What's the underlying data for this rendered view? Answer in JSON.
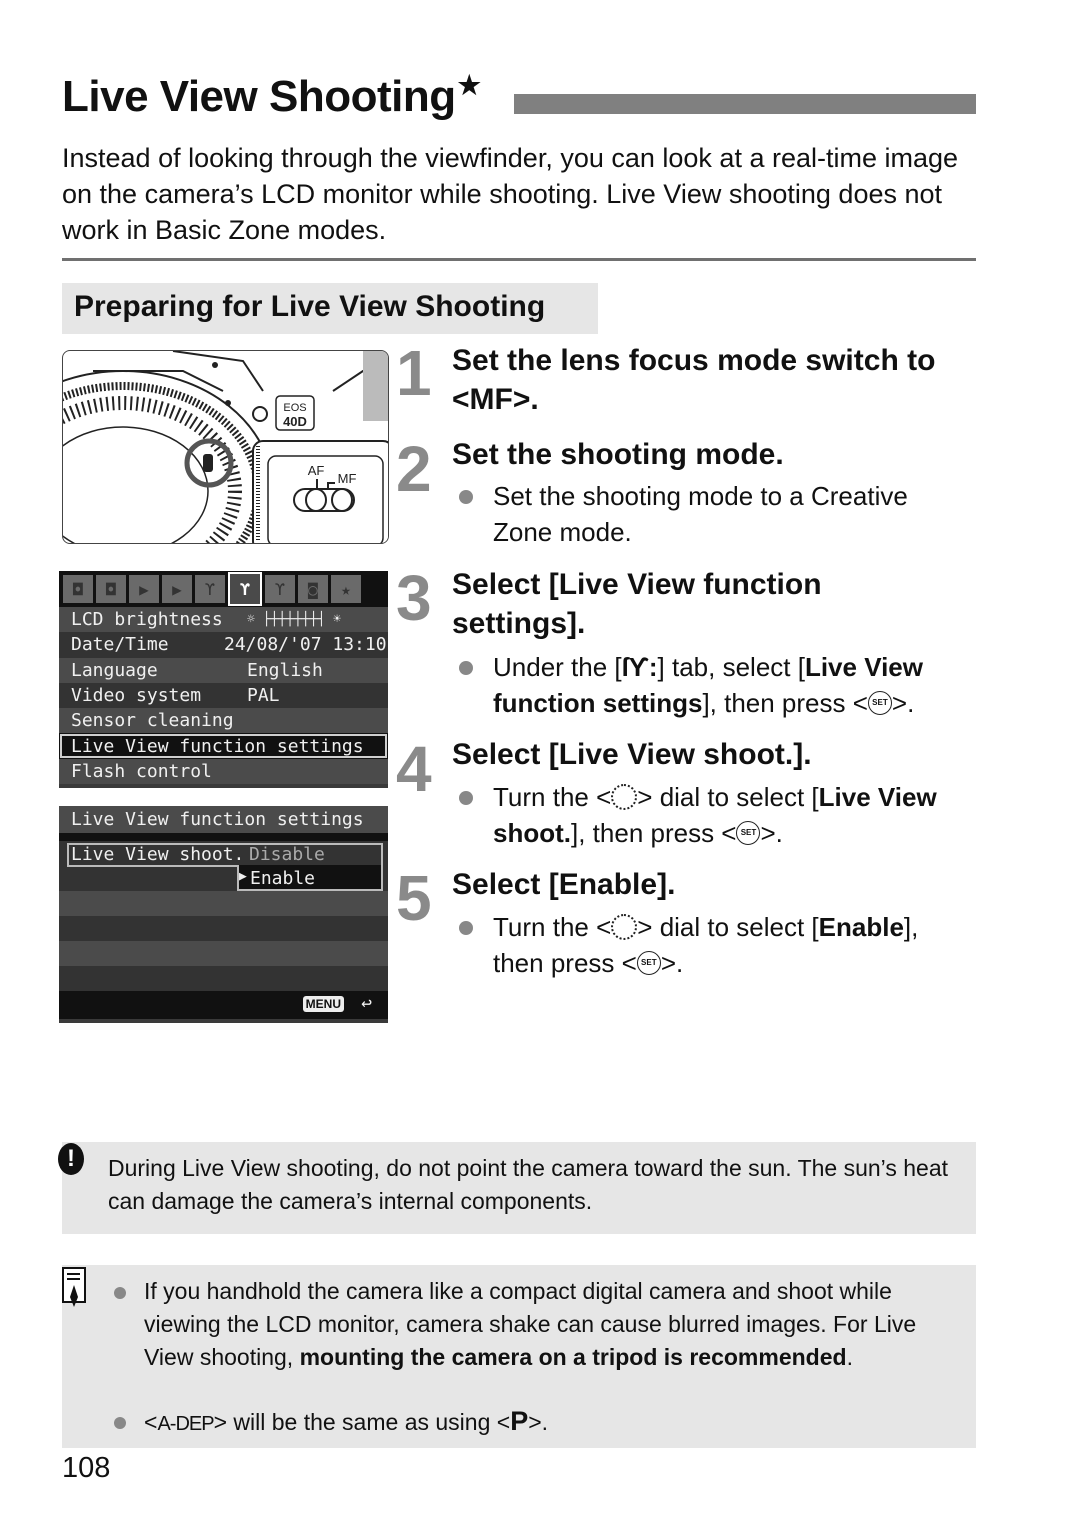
{
  "page": {
    "title": "Live View Shooting",
    "title_star": "★",
    "intro": "Instead of looking through the viewfinder, you can look at a real-time image on the camera’s LCD monitor while shooting. Live View shooting does not work in Basic Zone modes.",
    "section_heading": "Preparing for Live View Shooting",
    "page_number": "108"
  },
  "camera_illustration": {
    "model_badge_line1": "EOS",
    "model_badge_line2": "40D",
    "switch_af": "AF",
    "switch_mf": "MF"
  },
  "lcd_menu": {
    "tabs": [
      "shoot1",
      "shoot2",
      "play1",
      "play2",
      "setup1",
      "setup2",
      "setup3",
      "custom",
      "mymenu"
    ],
    "active_tab": 5,
    "rows": [
      {
        "label": "LCD brightness",
        "value": "☼ ├┼┼┼┼┼┼┤ ☀"
      },
      {
        "label": "Date/Time",
        "value": "24/08/'07 13:10"
      },
      {
        "label": "Language",
        "value": "English"
      },
      {
        "label": "Video system",
        "value": "PAL"
      },
      {
        "label": "Sensor cleaning",
        "value": ""
      },
      {
        "label": "Live View function settings",
        "value": "",
        "selected": true
      },
      {
        "label": "Flash control",
        "value": ""
      }
    ]
  },
  "lcd_submenu": {
    "title": "Live View function settings",
    "item_label": "Live View shoot.",
    "options": [
      "Disable",
      "Enable"
    ],
    "selected_option": "Enable",
    "menu_button": "MENU",
    "back_glyph": "↩"
  },
  "steps": [
    {
      "num": "1",
      "title": "Set the lens focus mode switch to <MF>."
    },
    {
      "num": "2",
      "title": "Set the shooting mode.",
      "bullet": "Set the shooting mode to a Creative Zone mode."
    },
    {
      "num": "3",
      "title": "Select [Live View function settings].",
      "bullet_parts": [
        "Under the [",
        "] tab, select [",
        "Live View function settings",
        "], then press <",
        ">."
      ]
    },
    {
      "num": "4",
      "title": "Select [Live View shoot.].",
      "bullet_parts": [
        "Turn the <",
        "> dial to select [",
        "Live View shoot.",
        "], then press <",
        ">."
      ]
    },
    {
      "num": "5",
      "title": "Select [Enable].",
      "bullet_parts": [
        "Turn the <",
        "> dial to select [",
        "Enable",
        "],",
        "then press <",
        ">."
      ]
    }
  ],
  "icons": {
    "set_button": "SET",
    "setup_tab": "ſϒ:"
  },
  "caution": {
    "icon": "!",
    "text": "During Live View shooting, do not point the camera toward the sun. The sun’s heat can damage the camera’s internal components."
  },
  "memo": {
    "bullet1_normal": "If you handhold the camera like a compact digital camera and shoot while viewing the LCD monitor, camera shake can cause blurred images. For Live View shooting, ",
    "bullet1_bold": "mounting the camera on a tripod is recommended",
    "bullet1_end": ".",
    "bullet2_mode_a": "A-DEP",
    "bullet2_middle": " will be the same as using ",
    "bullet2_mode_p": "P",
    "bullet2_end": "."
  }
}
